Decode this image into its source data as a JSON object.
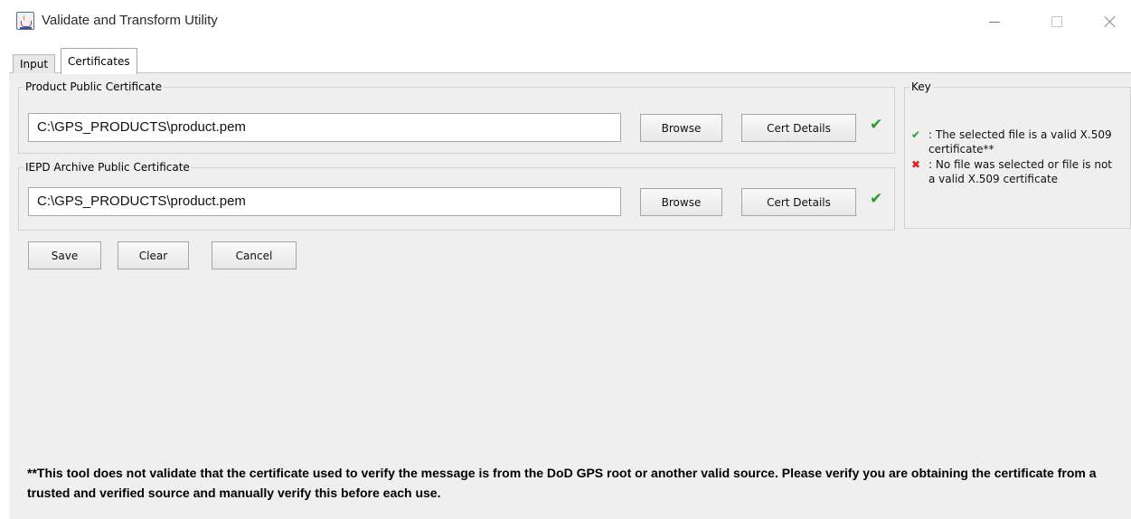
{
  "window": {
    "title": "Validate and Transform Utility"
  },
  "tabs": [
    {
      "label": "Input"
    },
    {
      "label": "Certificates"
    }
  ],
  "product_cert": {
    "group_title": "Product Public Certificate",
    "path": "C:\\GPS_PRODUCTS\\product.pem",
    "browse_label": "Browse",
    "details_label": "Cert Details",
    "status_mark": "✔"
  },
  "iepd_cert": {
    "group_title": "IEPD Archive Public Certificate",
    "path": "C:\\GPS_PRODUCTS\\product.pem",
    "browse_label": "Browse",
    "details_label": "Cert Details",
    "status_mark": "✔"
  },
  "key": {
    "title": "Key",
    "valid_mark": "✔",
    "valid_line1": ": The selected file is a valid X.509",
    "valid_line2": "certificate**",
    "invalid_mark": "✖",
    "invalid_line1": ": No file was selected or file is not",
    "invalid_line2": "a valid X.509 certificate"
  },
  "actions": {
    "save_label": "Save",
    "clear_label": "Clear",
    "cancel_label": "Cancel"
  },
  "footnote": "**This tool does not validate that the certificate used to verify the message is from the DoD GPS root or another valid source. Please verify you are obtaining the certificate from a trusted and verified source and manually verify this before each use.",
  "colors": {
    "valid": "#22a022",
    "invalid": "#e02020"
  }
}
